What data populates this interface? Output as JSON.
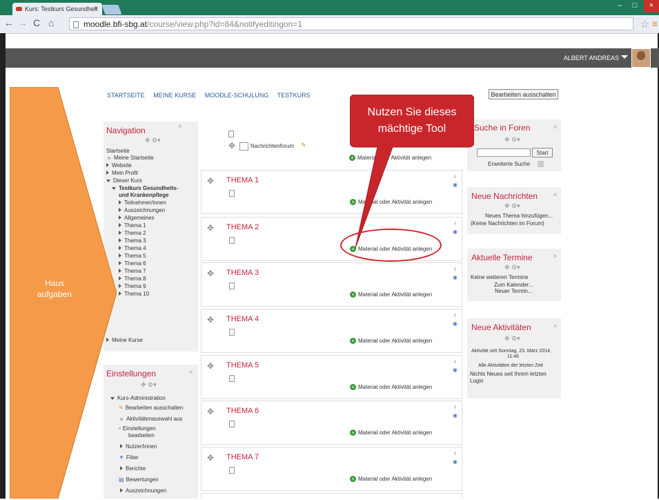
{
  "browser": {
    "tab_title": "Kurs: Testkurs Gesundheit",
    "url_host": "moodle.bfi-sbg.at",
    "url_path": "/course/view.php?id=84&notifyeditingon=1"
  },
  "header": {
    "user": "ALBERT ANDREAS"
  },
  "breadcrumb": [
    "STARTSEITE",
    "MEINE KURSE",
    "MOODLE-SCHULUNG",
    "TESTKURS"
  ],
  "edit_button": "Bearbeiten ausschalten",
  "navigation": {
    "title": "Navigation",
    "items": [
      "Startseite",
      "Meine Startseite",
      "Website",
      "Mein Profil",
      "Dieser Kurs",
      "Testkurs Gesundheits-",
      "und Krankenpflege",
      "Teilnehmer/innen",
      "Auszeichnungen",
      "Allgemeines",
      "Thema 1",
      "Thema 2",
      "Thema 3",
      "Thema 4",
      "Thema 5",
      "Thema 6",
      "Thema 7",
      "Thema 8",
      "Thema 9",
      "Thema 10",
      "Meine Kurse"
    ]
  },
  "settings": {
    "title": "Einstellungen",
    "items": [
      "Kurs-Administration",
      "Bearbeiten ausschalten",
      "Aktivitätenauswahl aus",
      "Einstellungen",
      "bearbeiten",
      "Nutzer/innen",
      "Filter",
      "Berichte",
      "Bewertungen",
      "Auszeichnungen"
    ]
  },
  "course": {
    "forum": "Nachrichtenforum",
    "add_label": "Material oder Aktivität anlegen",
    "sections": [
      "THEMA 1",
      "THEMA 2",
      "THEMA 3",
      "THEMA 4",
      "THEMA 5",
      "THEMA 6",
      "THEMA 7"
    ]
  },
  "search_forums": {
    "title": "Suche in Foren",
    "button": "Start",
    "advanced": "Erweiterte Suche"
  },
  "news": {
    "title": "Neue Nachrichten",
    "add": "Neues Thema hinzufügen...",
    "empty": "(Keine Nachrichten im Forum)"
  },
  "events": {
    "title": "Aktuelle Termine",
    "none": "Keine weiteren Termine",
    "calendar": "Zum Kalender...",
    "new": "Neuer Termin..."
  },
  "activities": {
    "title": "Neue Aktivitäten",
    "since1": "Aktivität seit Sonntag, 23. März 2014,",
    "since2": "11:46",
    "all": "Alle Aktivitäten der letzten Zeit",
    "none1": "Nichts Neues seit Ihrem letzten",
    "none2": "Login"
  },
  "annotation": {
    "arrow_text1": "Haus",
    "arrow_text2": "aufgaben",
    "callout1": "Nutzen Sie dieses",
    "callout2": "mächtige Tool"
  },
  "colors": {
    "accent": "#c4223b",
    "arrow": "#f59a48",
    "callout": "#c9262c"
  }
}
